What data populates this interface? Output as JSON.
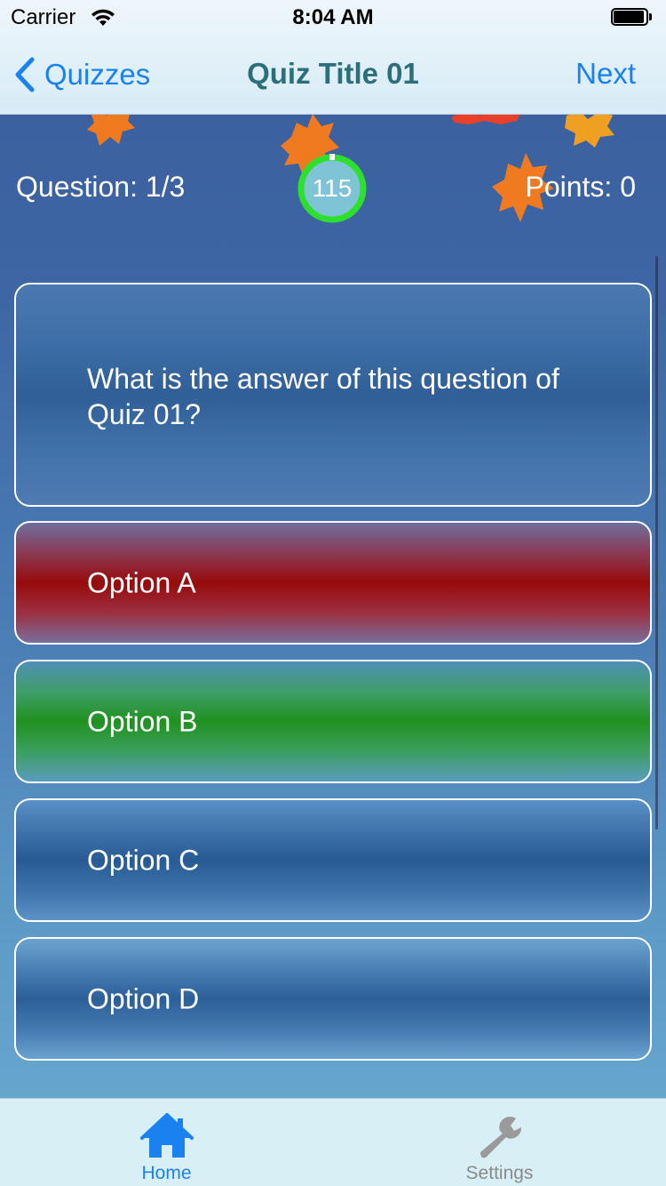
{
  "status_bar": {
    "carrier": "Carrier",
    "time": "8:04 AM",
    "icons": [
      "wifi-icon",
      "battery-icon"
    ]
  },
  "nav": {
    "back_label": "Quizzes",
    "title": "Quiz Title 01",
    "next_label": "Next",
    "accent_color": "#1a82f0",
    "title_color": "#2b6f7a"
  },
  "quiz": {
    "question_counter": "Question: 1/3",
    "timer_value": "115",
    "points": "Points: 0",
    "question": "What is the answer of this question of Quiz 01?",
    "options": [
      {
        "label": "Option A",
        "state": "wrong",
        "color": "#970b0b"
      },
      {
        "label": "Option B",
        "state": "correct",
        "color": "#209220"
      },
      {
        "label": "Option C",
        "state": "neutral",
        "color": "#285b94"
      },
      {
        "label": "Option D",
        "state": "neutral",
        "color": "#2c5f98"
      }
    ]
  },
  "tabbar": {
    "tabs": [
      {
        "label": "Home",
        "icon": "home-icon",
        "selected": true
      },
      {
        "label": "Settings",
        "icon": "wrench-icon",
        "selected": false
      }
    ]
  }
}
